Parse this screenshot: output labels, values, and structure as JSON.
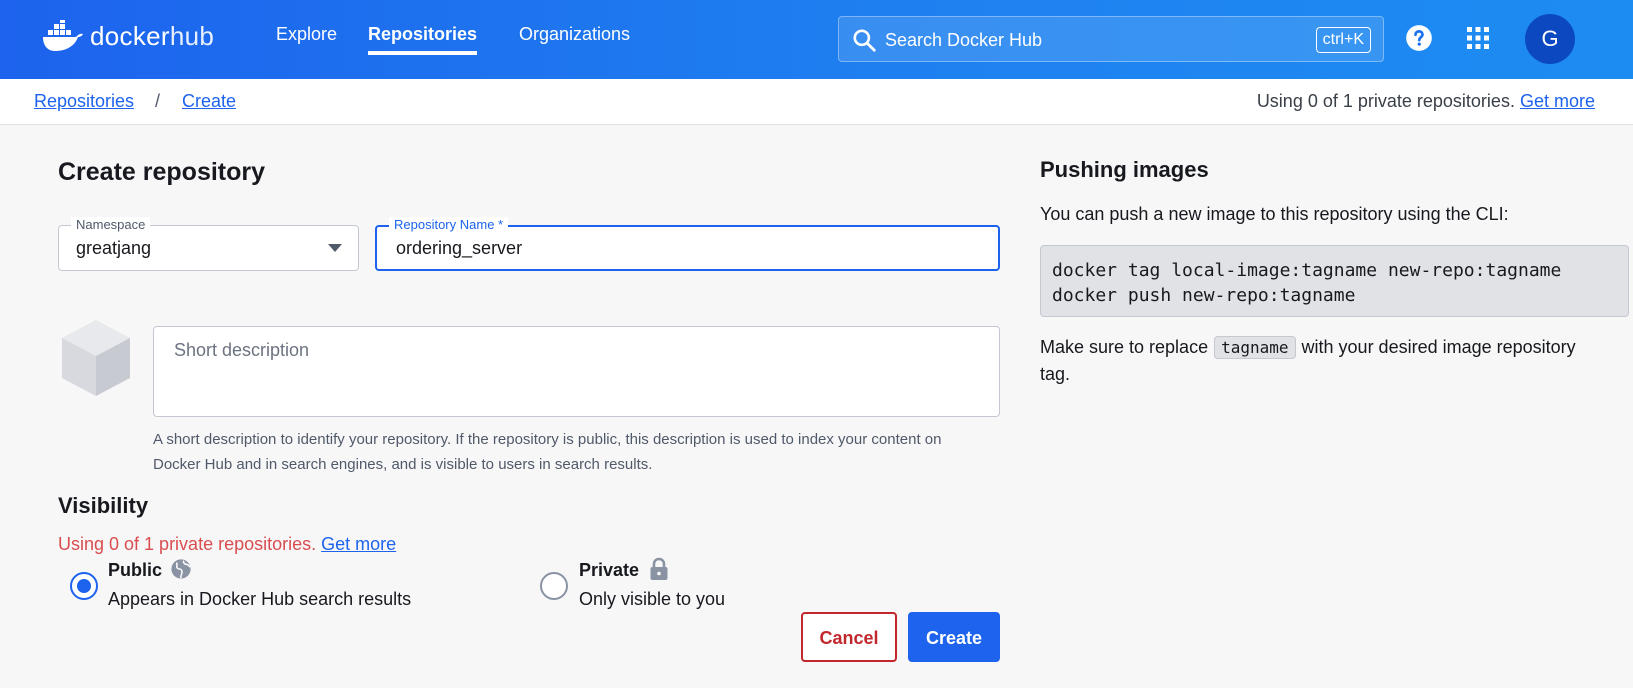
{
  "header": {
    "logo_text": "docker",
    "logo_text_hub": "hub",
    "nav": [
      {
        "label": "Explore",
        "active": false
      },
      {
        "label": "Repositories",
        "active": true
      },
      {
        "label": "Organizations",
        "active": false
      }
    ],
    "search": {
      "placeholder": "Search Docker Hub",
      "shortcut": "ctrl+K"
    },
    "avatar_initial": "G",
    "brand_color": "#1d63ed"
  },
  "breadcrumb": {
    "items": [
      "Repositories",
      "Create"
    ],
    "separator": "/",
    "usage_text": "Using 0 of 1 private repositories.",
    "usage_link": "Get more"
  },
  "form": {
    "title": "Create repository",
    "namespace": {
      "label": "Namespace",
      "value": "greatjang"
    },
    "repo_name": {
      "label": "Repository Name *",
      "value": "ordering_server"
    },
    "description": {
      "placeholder": "Short description",
      "helper": "A short description to identify your repository. If the repository is public, this description is used to index your content on Docker Hub and in search engines, and is visible to users in search results."
    },
    "visibility": {
      "title": "Visibility",
      "usage_text": "Using 0 of 1 private repositories.",
      "usage_link": "Get more",
      "options": [
        {
          "label": "Public",
          "sub": "Appears in Docker Hub search results",
          "checked": true,
          "icon": "globe-icon"
        },
        {
          "label": "Private",
          "sub": "Only visible to you",
          "checked": false,
          "icon": "lock-icon"
        }
      ]
    },
    "cancel_label": "Cancel",
    "create_label": "Create"
  },
  "push": {
    "title": "Pushing images",
    "intro": "You can push a new image to this repository using the CLI:",
    "code_lines": [
      "docker tag local-image:tagname new-repo:tagname",
      "docker push new-repo:tagname"
    ],
    "note_before": "Make sure to replace",
    "note_code": "tagname",
    "note_after": "with your desired image repository tag."
  }
}
